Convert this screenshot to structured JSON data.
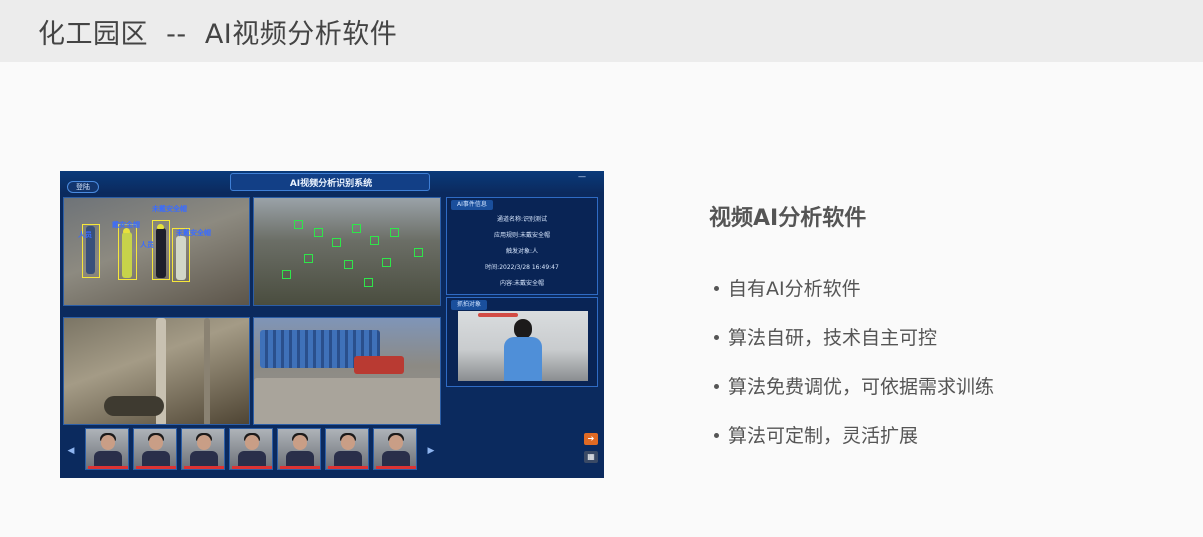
{
  "header": {
    "title": "化工园区  --  AI视频分析软件"
  },
  "screenshot": {
    "app_title": "AI视频分析识别系统",
    "login_label": "登陆",
    "window_control": "—",
    "cam1_labels": [
      "未戴安全帽",
      "戴安全帽",
      "人员",
      "人员",
      "未戴安全帽"
    ],
    "event_panel": {
      "header": "AI事件信息",
      "lines": [
        "通道名称:识别测试",
        "应用规则:未戴安全帽",
        "触发对象:人",
        "时间:2022/3/28 16:49:47",
        "内容:未戴安全帽"
      ]
    },
    "capture_panel": {
      "header": "抓拍对象"
    },
    "nav_prev": "◀",
    "nav_next": "▶",
    "side_btn_1": "➔",
    "side_btn_2": "▦"
  },
  "right": {
    "title": "视频AI分析软件",
    "bullets": [
      "自有AI分析软件",
      "算法自研，技术自主可控",
      "算法免费调优，可依据需求训练",
      "算法可定制，灵活扩展"
    ]
  },
  "colors": {
    "panel_bg": "#0b2a5e",
    "accent_blue": "#2f6bc4",
    "header_bg": "#ececec"
  }
}
